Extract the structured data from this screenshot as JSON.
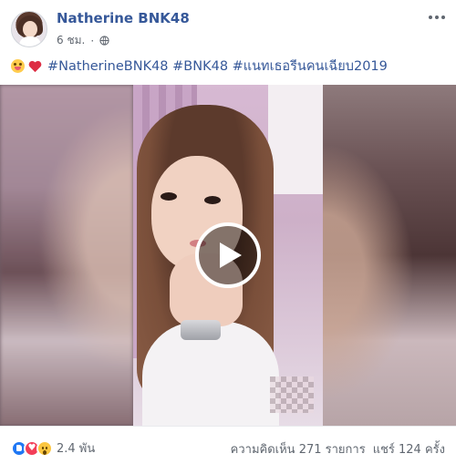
{
  "post": {
    "page_name": "Natherine BNK48",
    "timestamp": "6 ชม.",
    "separator": "·",
    "privacy_icon": "globe-icon",
    "caption_emojis": [
      "squinting-face-tongue-emoji",
      "red-heart-emoji"
    ],
    "caption_text": "#NatherineBNK48 #BNK48 #แนทเธอรีนคนเฉียบ2019"
  },
  "video": {
    "play_icon": "play-icon"
  },
  "footer": {
    "reaction_types": [
      "like",
      "love",
      "wow"
    ],
    "reaction_count": "2.4 พัน",
    "comments": "ความคิดเห็น 271 รายการ",
    "shares": "แชร์ 124 ครั้ง"
  },
  "colors": {
    "link_blue": "#365899",
    "meta_gray": "#616770",
    "like_blue": "#2078f4",
    "love_red": "#f33e58",
    "wow_yellow": "#fcc641"
  }
}
